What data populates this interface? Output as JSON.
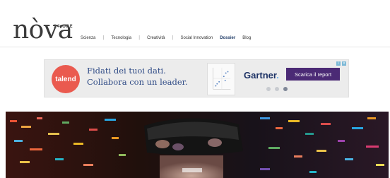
{
  "brand": {
    "logo_text": "nòva",
    "logo_mark": "24 ORE"
  },
  "nav": {
    "items": [
      "Scienza",
      "Tecnologia",
      "Creatività",
      "Social Innovation"
    ],
    "separator": "|",
    "dossier": "Dossier",
    "blog": "Blog"
  },
  "ad": {
    "brand_circle": "talend",
    "headline_line1": "Fidati dei tuoi dati.",
    "headline_line2": "Collabora con un leader.",
    "partner": "Gartner",
    "partner_dot": ".",
    "cta": "Scarica il report",
    "carousel_pages": 3,
    "carousel_active": 3
  },
  "hero": {
    "alt_subject": "person-wearing-vr-headset"
  },
  "colors": {
    "headline": "#2f4b86",
    "cta_bg": "#4b2a75",
    "talend_red": "#ea5a4f",
    "dossier": "#1e3a66"
  }
}
